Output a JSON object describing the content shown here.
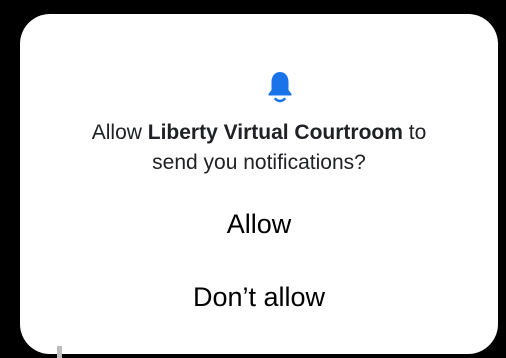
{
  "dialog": {
    "icon": "bell-icon",
    "accent_color": "#1a73e8",
    "message_prefix": "Allow ",
    "app_name": "Liberty Virtual Courtroom",
    "message_suffix_line1": " to",
    "message_line2": "send you notifications?",
    "allow_label": "Allow",
    "deny_label": "Don’t allow"
  }
}
